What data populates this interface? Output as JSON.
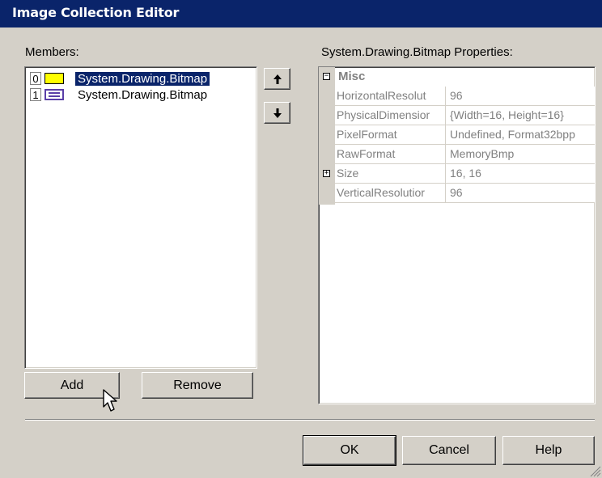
{
  "window": {
    "title": "Image Collection Editor"
  },
  "members": {
    "label": "Members:",
    "items": [
      {
        "index": "0",
        "text": "System.Drawing.Bitmap",
        "thumb_color": "#ffff00",
        "selected": true
      },
      {
        "index": "1",
        "text": "System.Drawing.Bitmap",
        "thumb_color": "#5a3ea8",
        "selected": false
      }
    ]
  },
  "move_buttons": {
    "up_icon": "arrow-up-icon",
    "down_icon": "arrow-down-icon"
  },
  "properties": {
    "label": "System.Drawing.Bitmap  Properties:",
    "category": "Misc",
    "rows": [
      {
        "name": "HorizontalResolut",
        "value": "96",
        "expandable": false
      },
      {
        "name": "PhysicalDimensior",
        "value": "{Width=16, Height=16}",
        "expandable": false
      },
      {
        "name": "PixelFormat",
        "value": "Undefined, Format32bpp",
        "expandable": false
      },
      {
        "name": "RawFormat",
        "value": "MemoryBmp",
        "expandable": false
      },
      {
        "name": "Size",
        "value": "16, 16",
        "expandable": true
      },
      {
        "name": "VerticalResolutior",
        "value": "96",
        "expandable": false
      }
    ]
  },
  "buttons": {
    "add": "Add",
    "remove": "Remove",
    "ok": "OK",
    "cancel": "Cancel",
    "help": "Help"
  },
  "colors": {
    "titlebar": "#0a246a",
    "selection": "#0a246a",
    "dialog_bg": "#d4d0c8"
  }
}
